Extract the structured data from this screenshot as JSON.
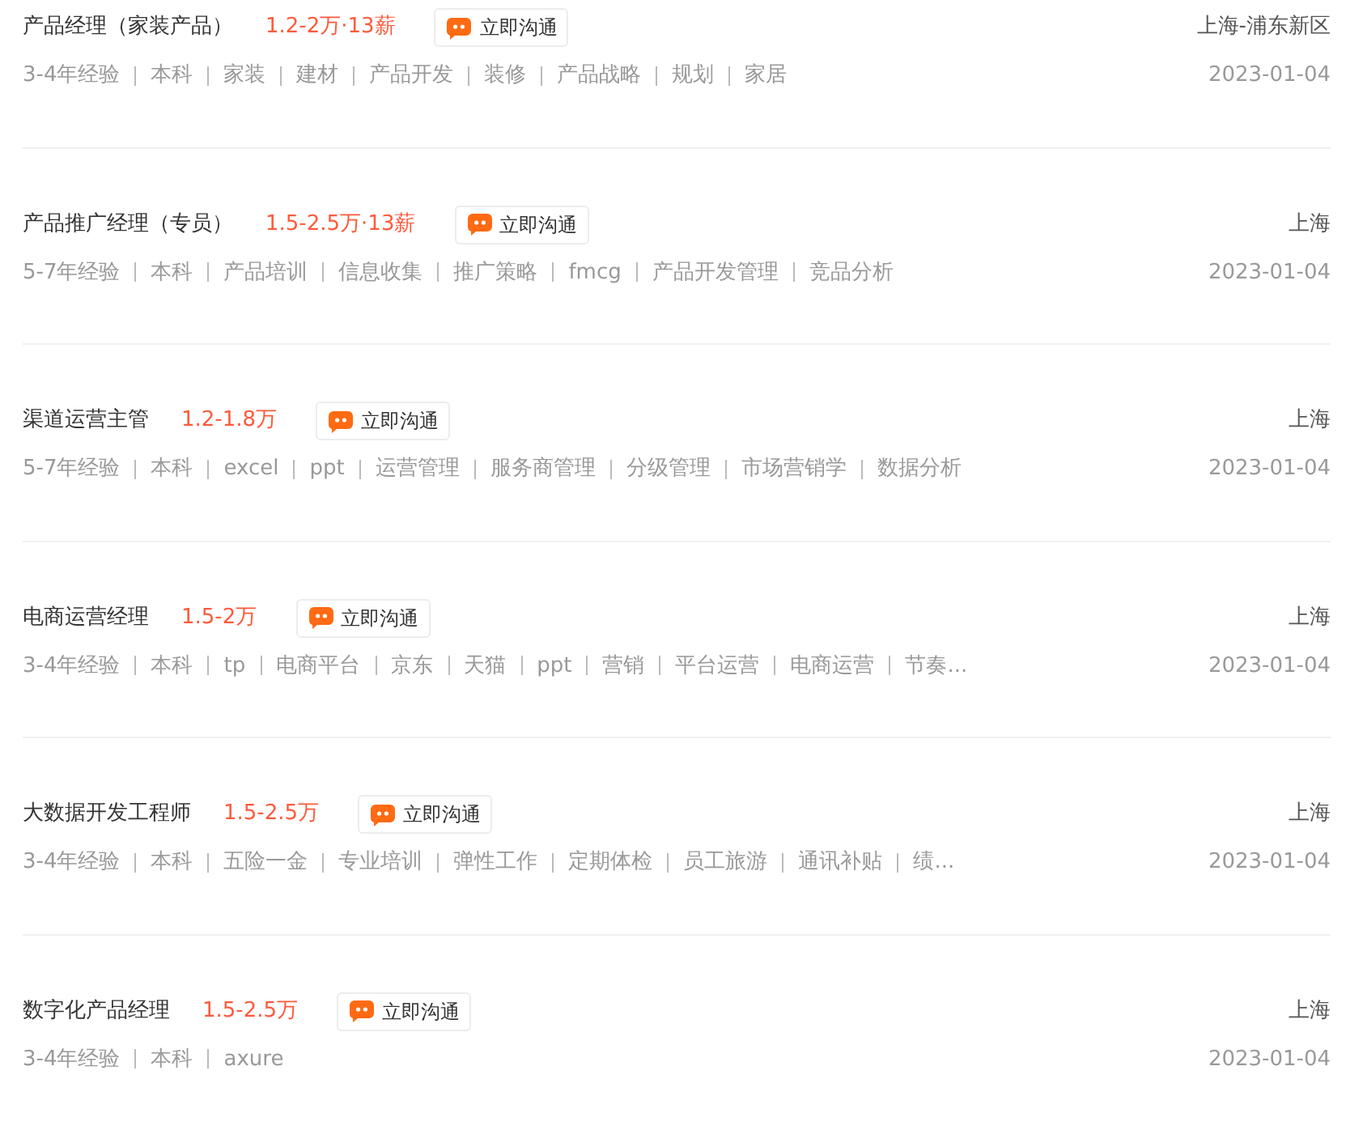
{
  "jobs": [
    {
      "title": "产品经理（家装产品）",
      "salary": "1.2-2万·13薪",
      "chat_button": "立即沟通",
      "location": "上海-浦东新区",
      "tags": [
        "3-4年经验",
        "本科",
        "家装",
        "建材",
        "产品开发",
        "装修",
        "产品战略",
        "规划",
        "家居"
      ],
      "date": "2023-01-04"
    },
    {
      "title": "产品推广经理（专员）",
      "salary": "1.5-2.5万·13薪",
      "chat_button": "立即沟通",
      "location": "上海",
      "tags": [
        "5-7年经验",
        "本科",
        "产品培训",
        "信息收集",
        "推广策略",
        "fmcg",
        "产品开发管理",
        "竞品分析"
      ],
      "date": "2023-01-04"
    },
    {
      "title": "渠道运营主管",
      "salary": "1.2-1.8万",
      "chat_button": "立即沟通",
      "location": "上海",
      "tags": [
        "5-7年经验",
        "本科",
        "excel",
        "ppt",
        "运营管理",
        "服务商管理",
        "分级管理",
        "市场营销学",
        "数据分析"
      ],
      "date": "2023-01-04"
    },
    {
      "title": "电商运营经理",
      "salary": "1.5-2万",
      "chat_button": "立即沟通",
      "location": "上海",
      "tags": [
        "3-4年经验",
        "本科",
        "tp",
        "电商平台",
        "京东",
        "天猫",
        "ppt",
        "营销",
        "平台运营",
        "电商运营",
        "节奏..."
      ],
      "date": "2023-01-04"
    },
    {
      "title": "大数据开发工程师",
      "salary": "1.5-2.5万",
      "chat_button": "立即沟通",
      "location": "上海",
      "tags": [
        "3-4年经验",
        "本科",
        "五险一金",
        "专业培训",
        "弹性工作",
        "定期体检",
        "员工旅游",
        "通讯补贴",
        "绩..."
      ],
      "date": "2023-01-04"
    },
    {
      "title": "数字化产品经理",
      "salary": "1.5-2.5万",
      "chat_button": "立即沟通",
      "location": "上海",
      "tags": [
        "3-4年经验",
        "本科",
        "axure"
      ],
      "date": "2023-01-04"
    }
  ]
}
